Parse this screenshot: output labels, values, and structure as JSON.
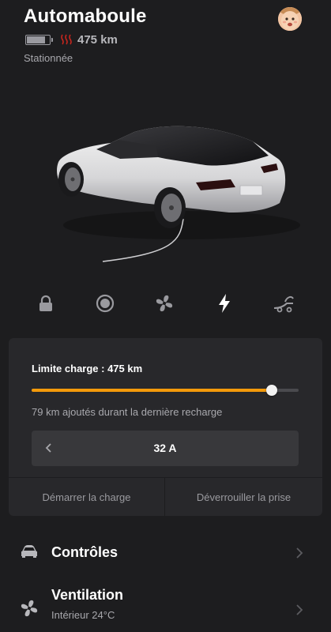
{
  "vehicle": {
    "name": "Automaboule",
    "range": "475 km",
    "state": "Stationnée",
    "battery_level": 0.82
  },
  "quick_actions": [
    {
      "icon": "lock-icon"
    },
    {
      "icon": "sentry-icon"
    },
    {
      "icon": "fan-icon"
    },
    {
      "icon": "lightning-icon"
    },
    {
      "icon": "trunk-icon"
    }
  ],
  "charging": {
    "limit_label": "Limite charge : 475 km",
    "limit_fraction": 0.9,
    "added_text": "79 km ajoutés durant la dernière recharge",
    "current": "32 A",
    "start_label": "Démarrer la charge",
    "unlock_label": "Déverrouiller la prise"
  },
  "menu": [
    {
      "title": "Contrôles",
      "subtitle": "",
      "icon": "car-icon"
    },
    {
      "title": "Ventilation",
      "subtitle": "Intérieur 24°C",
      "icon": "fan-icon"
    }
  ],
  "colors": {
    "background": "#1d1d1f",
    "card": "#28282b",
    "accent": "#f39a0b",
    "heat_icon": "#c8261e"
  }
}
